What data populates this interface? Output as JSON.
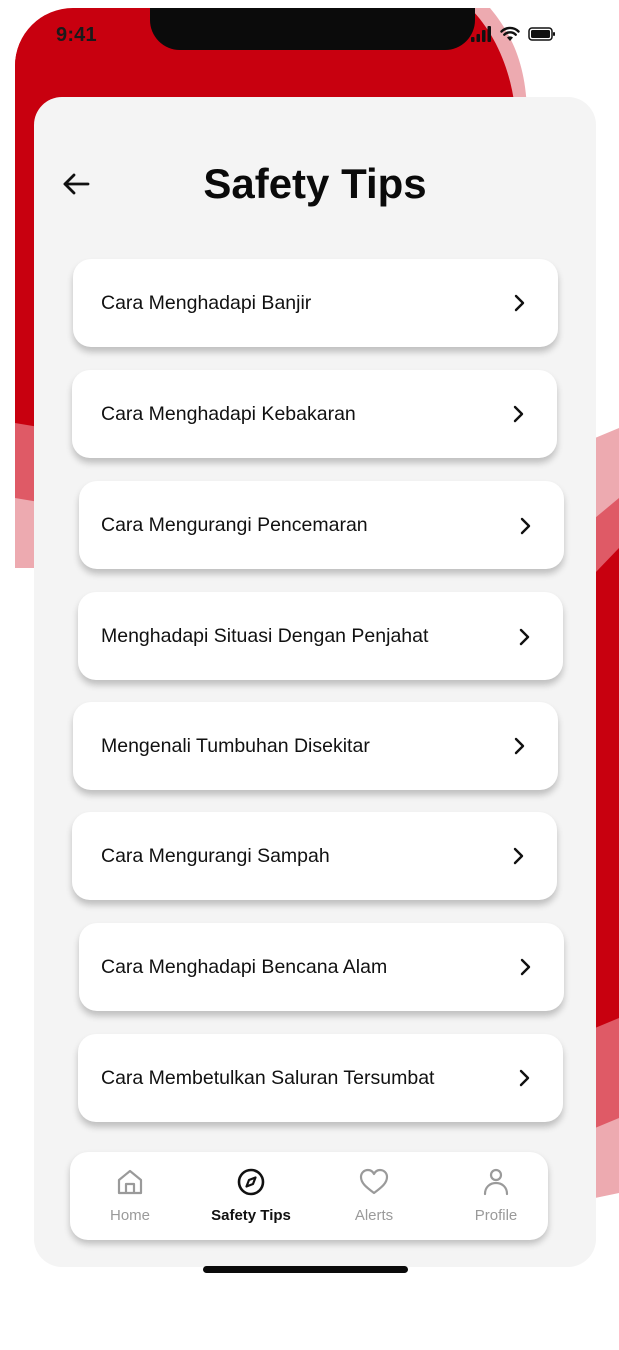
{
  "status_bar": {
    "time": "9:41"
  },
  "header": {
    "title": "Safety Tips",
    "back_icon": "arrow-left-icon"
  },
  "tips": [
    {
      "label": "Cara Menghadapi Banjir"
    },
    {
      "label": "Cara Menghadapi Kebakaran"
    },
    {
      "label": "Cara Mengurangi Pencemaran"
    },
    {
      "label": "Menghadapi Situasi Dengan Penjahat"
    },
    {
      "label": "Mengenali Tumbuhan Disekitar"
    },
    {
      "label": "Cara Mengurangi Sampah"
    },
    {
      "label": "Cara Menghadapi Bencana Alam"
    },
    {
      "label": "Cara Membetulkan Saluran Tersumbat"
    }
  ],
  "nav": {
    "items": [
      {
        "label": "Home",
        "icon": "home-icon",
        "active": false
      },
      {
        "label": "Safety Tips",
        "icon": "compass-icon",
        "active": true
      },
      {
        "label": "Alerts",
        "icon": "heart-icon",
        "active": false
      },
      {
        "label": "Profile",
        "icon": "user-icon",
        "active": false
      }
    ]
  },
  "colors": {
    "brand_red": "#C8000F",
    "mid_red": "#DF5A66",
    "light_red": "#EDAAB0",
    "card_bg": "#F4F4F4",
    "inactive_nav": "#9A9A9A"
  }
}
